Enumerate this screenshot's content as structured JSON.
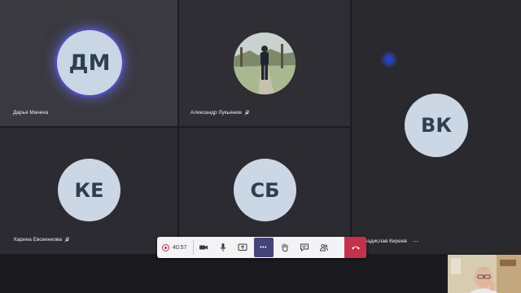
{
  "participants": [
    {
      "name": "Дарья Мачеча",
      "initials": "ДМ"
    },
    {
      "name": "Александр Лукьянюк"
    },
    {
      "name": "Владислав Киреев",
      "initials": "ВК",
      "more": "···"
    },
    {
      "name": "Карина Евсеенкова",
      "initials": "КЕ"
    },
    {
      "initials": "СБ"
    }
  ],
  "toolbar": {
    "timer": "40:57",
    "more_label": "•••"
  },
  "colors": {
    "accent": "#44447a",
    "hangup": "#c4314b",
    "avatar_bg": "#cbd7e4",
    "speaking_ring": "#4c4cb8"
  },
  "icons": [
    "record-icon",
    "camera-icon",
    "microphone-icon",
    "share-screen-icon",
    "more-icon",
    "raise-hand-icon",
    "chat-icon",
    "participants-icon",
    "hang-up-icon",
    "mic-off-icon"
  ]
}
